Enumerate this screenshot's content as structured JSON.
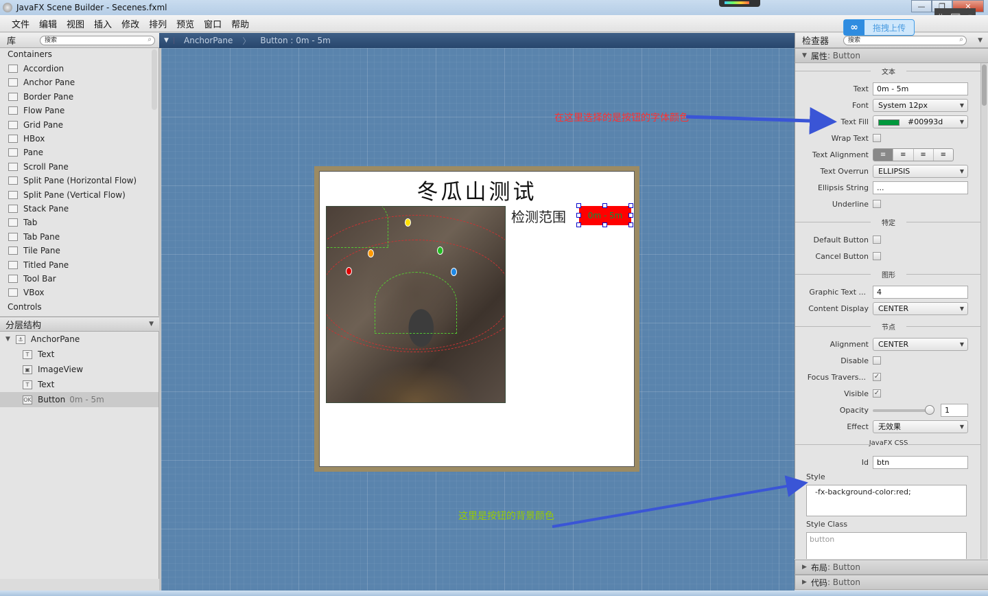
{
  "window": {
    "title": "JavaFX Scene Builder - Secenes.fxml",
    "min": "—",
    "max": "❐",
    "close": "✕"
  },
  "menubar": [
    "文件",
    "编辑",
    "视图",
    "插入",
    "修改",
    "排列",
    "预览",
    "窗口",
    "帮助"
  ],
  "upload_widget": {
    "label": "拖拽上传",
    "icon": "cloud-icon"
  },
  "library": {
    "title": "库",
    "search_placeholder": "搜索",
    "section_containers": "Containers",
    "items": [
      "Accordion",
      "Anchor Pane",
      "Border Pane",
      "Flow Pane",
      "Grid Pane",
      "HBox",
      "Pane",
      "Scroll Pane",
      "Split Pane (Horizontal Flow)",
      "Split Pane (Vertical Flow)",
      "Stack Pane",
      "Tab",
      "Tab Pane",
      "Tile Pane",
      "Titled Pane",
      "Tool Bar",
      "VBox"
    ],
    "section_controls": "Controls"
  },
  "hierarchy": {
    "title": "分层结构",
    "root": "AnchorPane",
    "children": [
      {
        "type": "Text",
        "detail": ""
      },
      {
        "type": "ImageView",
        "detail": ""
      },
      {
        "type": "Text",
        "detail": ""
      },
      {
        "type": "Button",
        "detail": "0m - 5m",
        "selected": true
      }
    ]
  },
  "breadcrumb": [
    "AnchorPane",
    "Button : 0m - 5m"
  ],
  "scene": {
    "title": "冬瓜山测试",
    "range_label": "检测范围",
    "button_text": "0m - 5m",
    "button_bg": "#ff0000",
    "button_fg": "#00993d",
    "markers": [
      "#e00000",
      "#ff9900",
      "#ffe000",
      "#22bb22",
      "#1e88e5"
    ]
  },
  "annotations": {
    "text_fill_note": "在这里选择的是按钮的字体颜色",
    "style_note": "这里是按钮的背景颜色",
    "text_fill_note_color": "#ff3030",
    "style_note_color": "#99cc00"
  },
  "inspector": {
    "title": "检查器",
    "search_placeholder": "搜索",
    "properties_header": "属性",
    "properties_sub": ": Button",
    "group_text": "文本",
    "text_label": "Text",
    "text_value": "0m - 5m",
    "font_label": "Font",
    "font_value": "System 12px",
    "text_fill_label": "Text Fill",
    "text_fill_value": "#00993d",
    "wrap_label": "Wrap Text",
    "align_label": "Text Alignment",
    "overrun_label": "Text Overrun",
    "overrun_value": "ELLIPSIS",
    "ellipsis_label": "Ellipsis String",
    "ellipsis_value": "...",
    "underline_label": "Underline",
    "group_specific": "特定",
    "default_btn_label": "Default Button",
    "cancel_btn_label": "Cancel Button",
    "group_graphic": "图形",
    "graphic_gap_label": "Graphic Text ...",
    "graphic_gap_value": "4",
    "content_display_label": "Content Display",
    "content_display_value": "CENTER",
    "group_node": "节点",
    "alignment_label": "Alignment",
    "alignment_value": "CENTER",
    "disable_label": "Disable",
    "focus_label": "Focus Travers...",
    "visible_label": "Visible",
    "opacity_label": "Opacity",
    "opacity_value": "1",
    "effect_label": "Effect",
    "effect_value": "无效果",
    "group_css": "JavaFX CSS",
    "id_label": "Id",
    "id_value": "btn",
    "style_label": "Style",
    "style_value": "-fx-background-color:red;",
    "style_class_label": "Style Class",
    "style_class_value": "button",
    "layout_header": "布局",
    "layout_sub": ": Button",
    "code_header": "代码",
    "code_sub": ": Button"
  }
}
